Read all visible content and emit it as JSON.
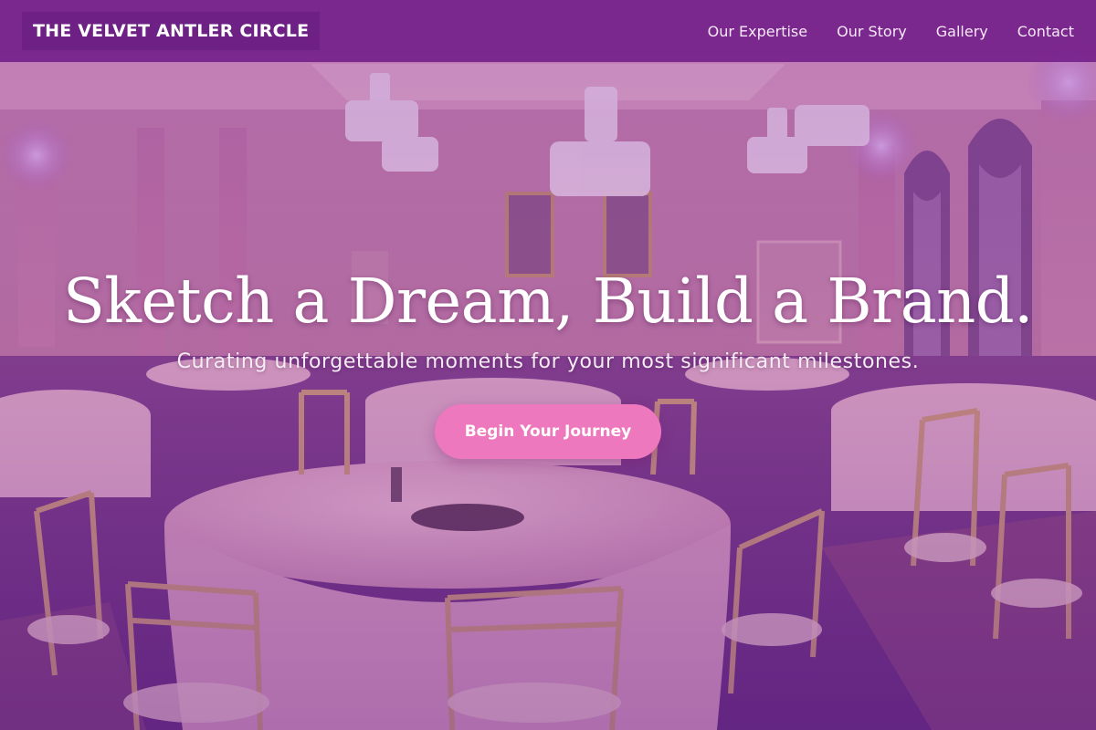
{
  "nav": {
    "brand": "THE VELVET ANTLER CIRCLE",
    "links": [
      {
        "label": "Our Expertise"
      },
      {
        "label": "Our Story"
      },
      {
        "label": "Gallery"
      },
      {
        "label": "Contact"
      }
    ]
  },
  "hero": {
    "headline": "Sketch a Dream, Build a Brand.",
    "subheadline": "Curating unforgettable moments for your most significant milestones.",
    "cta_label": "Begin Your Journey",
    "background": "ballroom-photo"
  },
  "colors": {
    "navbar": "#76228c",
    "cta": "#ee78be",
    "overlay": "#8a2c96",
    "text": "#ffffff"
  }
}
